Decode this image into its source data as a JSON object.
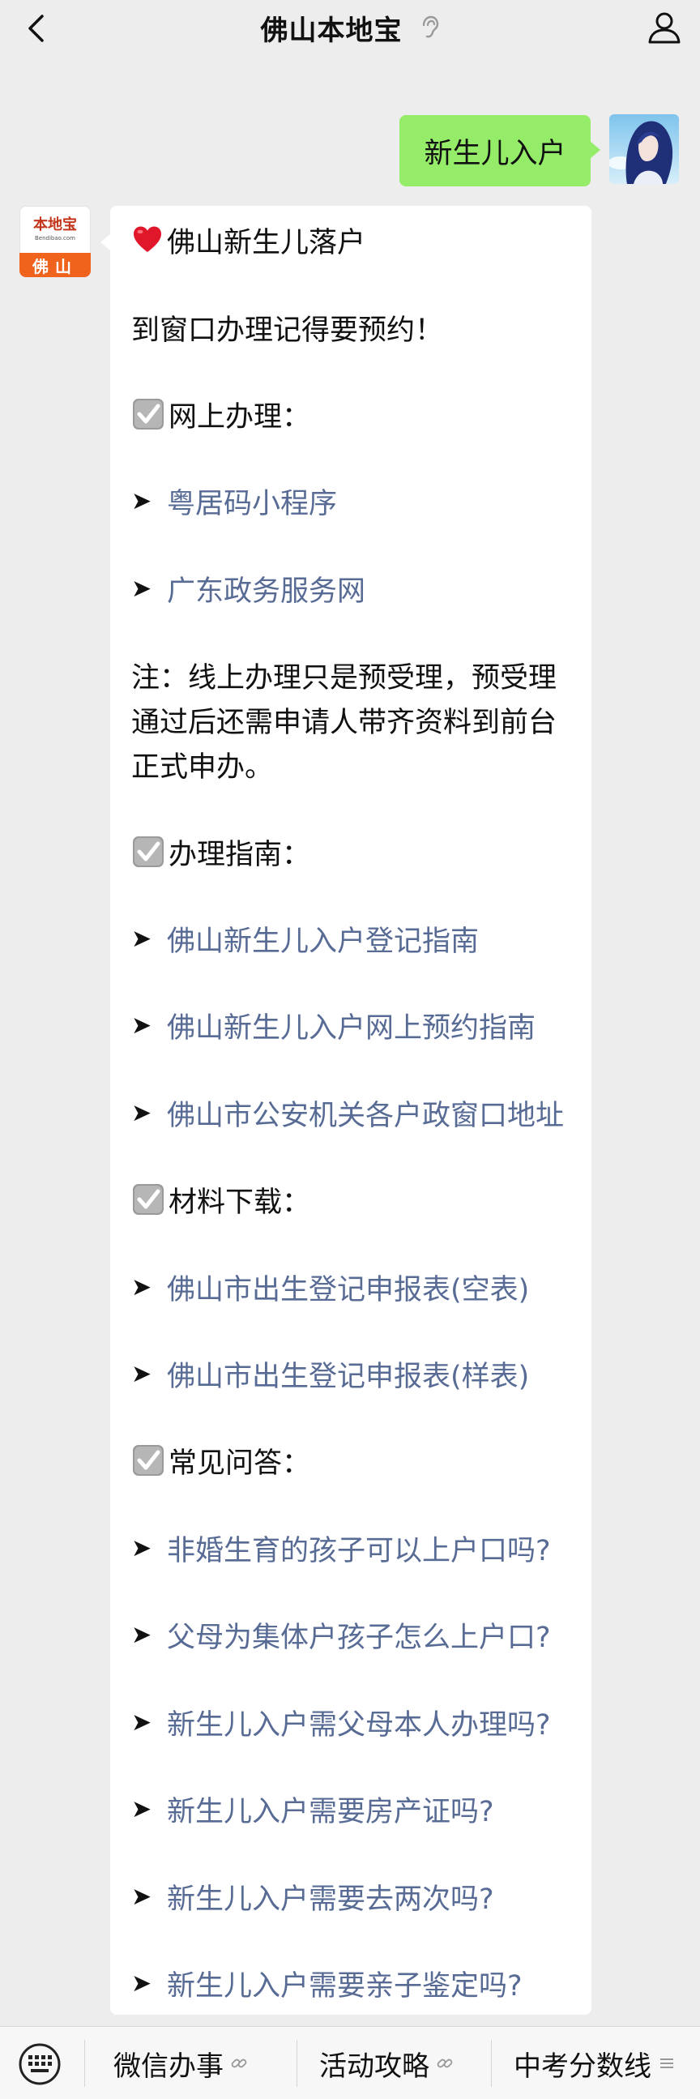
{
  "header": {
    "title": "佛山本地宝"
  },
  "user_message": {
    "text": "新生儿入户"
  },
  "bot": {
    "avatar": {
      "logo_name": "本地宝",
      "logo_url": "Bendibao.com",
      "city": "佛山"
    },
    "message": {
      "title": "佛山新生儿落户",
      "reminder": "到窗口办理记得要预约！",
      "sections": {
        "online": {
          "heading": "网上办理：",
          "links": [
            "粤居码小程序",
            "广东政务服务网"
          ]
        },
        "note": {
          "lines": [
            "注：线上办理只是预受理，预受理",
            "通过后还需申请人带齐资料到前台",
            "正式申办。"
          ]
        },
        "guide": {
          "heading": "办理指南：",
          "links": [
            "佛山新生儿入户登记指南",
            "佛山新生儿入户网上预约指南",
            "佛山市公安机关各户政窗口地址"
          ]
        },
        "download": {
          "heading": "材料下载：",
          "links": [
            "佛山市出生登记申报表(空表)",
            "佛山市出生登记申报表(样表)"
          ]
        },
        "faq": {
          "heading": "常见问答：",
          "links": [
            "非婚生育的孩子可以上户口吗?",
            "父母为集体户孩子怎么上户口?",
            "新生儿入户需父母本人办理吗?",
            "新生儿入户需要房产证吗?",
            "新生儿入户需要去两次吗?",
            "新生儿入户需要亲子鉴定吗?"
          ]
        }
      }
    }
  },
  "bottom_menu": {
    "items": [
      {
        "label": "微信办事",
        "icon": "link-icon"
      },
      {
        "label": "活动攻略",
        "icon": "link-icon"
      },
      {
        "label": "中考分数线",
        "icon": "menu-lines-icon"
      }
    ]
  },
  "colors": {
    "background": "#ededed",
    "user_bubble": "#95ec69",
    "link": "#576b95",
    "brand_orange": "#f0631d"
  }
}
